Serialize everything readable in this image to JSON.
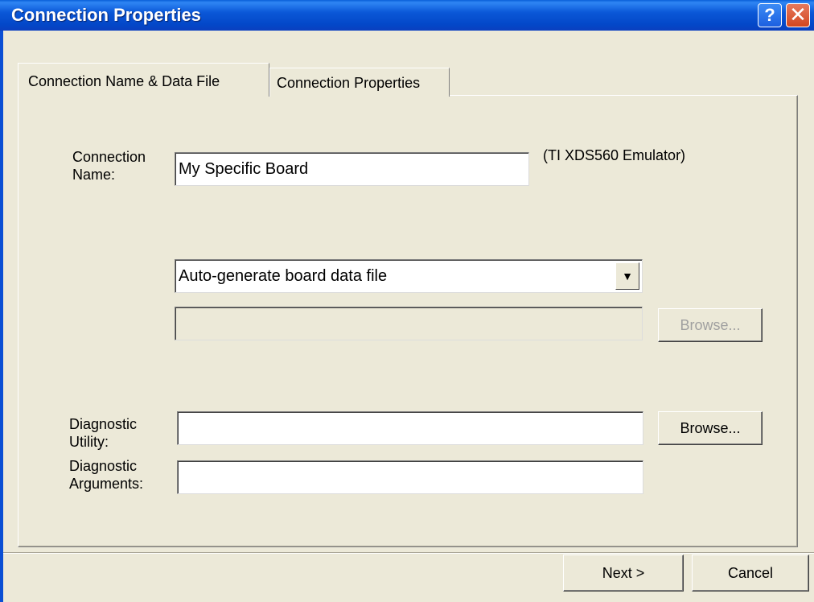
{
  "window": {
    "title": "Connection Properties",
    "help_button": "?",
    "close_button": "✕"
  },
  "tabs": [
    {
      "label": "Connection Name & Data File",
      "active": true
    },
    {
      "label": "Connection Properties",
      "active": false
    }
  ],
  "connection_name": {
    "label_line1": "Connection",
    "label_line2": "Name:",
    "value": "My Specific Board",
    "emulator_note": "(TI XDS560 Emulator)"
  },
  "board_data": {
    "selected_option": "Auto-generate board data file",
    "file_path_value": "",
    "browse_label": "Browse...",
    "browse_enabled": false
  },
  "diagnostic_utility": {
    "label_line1": "Diagnostic",
    "label_line2": "Utility:",
    "value": "",
    "browse_label": "Browse..."
  },
  "diagnostic_arguments": {
    "label_line1": "Diagnostic",
    "label_line2": "Arguments:",
    "value": ""
  },
  "footer": {
    "next_label": "Next >",
    "cancel_label": "Cancel"
  }
}
